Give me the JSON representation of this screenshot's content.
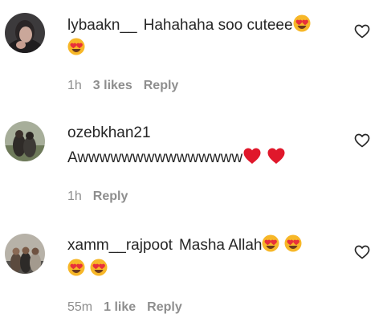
{
  "comments": [
    {
      "username": "lybaakn__",
      "text": "Hahahaha soo cuteee",
      "time": "1h",
      "likes": "3 likes",
      "reply": "Reply",
      "emojis_line1": [
        "smiling-heart-eyes"
      ],
      "emojis_line2": [
        "smiling-heart-eyes"
      ]
    },
    {
      "username": "ozebkhan21",
      "text": "Awwwwwwwwwwwwwww",
      "time": "1h",
      "reply": "Reply",
      "emojis_line1": [
        "red-heart",
        "red-heart"
      ]
    },
    {
      "username": "xamm__rajpoot",
      "text": "Masha Allah",
      "time": "55m",
      "likes": "1 like",
      "reply": "Reply",
      "emojis_line1": [
        "smiling-heart-eyes",
        "smiling-heart-eyes"
      ],
      "emojis_line2": [
        "smiling-heart-eyes",
        "smiling-heart-eyes"
      ]
    }
  ],
  "colors": {
    "text": "#262626",
    "secondary": "#8e8e8e",
    "heart": "#e0182b",
    "emoji_face": "#f7b728",
    "emoji_heart": "#e8303a"
  }
}
